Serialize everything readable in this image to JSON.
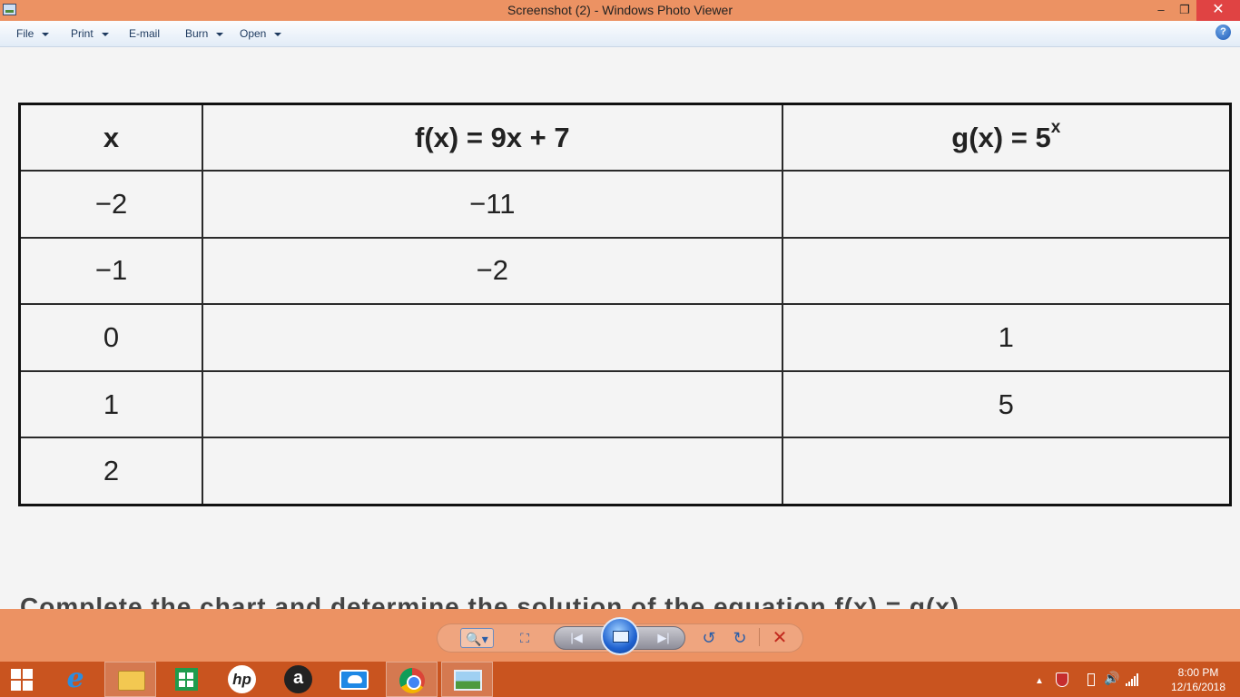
{
  "window": {
    "title": "Screenshot (2) - Windows Photo Viewer",
    "minimize_glyph": "‒",
    "maximize_glyph": "❐",
    "close_glyph": "✕"
  },
  "menu": {
    "items": [
      {
        "label": "File",
        "has_dropdown": true
      },
      {
        "label": "Print",
        "has_dropdown": true
      },
      {
        "label": "E-mail",
        "has_dropdown": false
      },
      {
        "label": "Burn",
        "has_dropdown": true
      },
      {
        "label": "Open",
        "has_dropdown": true
      }
    ],
    "help_glyph": "?"
  },
  "content": {
    "table": {
      "headers": {
        "x": "x",
        "f": "f(x) = 9x + 7",
        "g_base": "g(x) = 5",
        "g_exponent": "x"
      },
      "rows": [
        {
          "x": "−2",
          "f": "−11",
          "g": ""
        },
        {
          "x": "−1",
          "f": "−2",
          "g": ""
        },
        {
          "x": "0",
          "f": "",
          "g": "1"
        },
        {
          "x": "1",
          "f": "",
          "g": "5"
        },
        {
          "x": "2",
          "f": "",
          "g": ""
        }
      ]
    },
    "cut_off_text": "Complete the chart and determine the solution of the equation f(x) = g(x)."
  },
  "controls": {
    "zoom_glyph": "🔍▾",
    "fit_glyph": "⛶",
    "prev_glyph": "|◀",
    "next_glyph": "▶|",
    "rotate_left_glyph": "↺",
    "rotate_right_glyph": "↻",
    "delete_glyph": "✕"
  },
  "taskbar": {
    "ie_glyph": "e",
    "hp_glyph": "hp",
    "amazon_glyph": "a",
    "volume_glyph": "🔊",
    "chevron_glyph": "▲",
    "clock_time": "8:00 PM",
    "clock_date": "12/16/2018"
  },
  "colors": {
    "titlebar": "#ec9263",
    "taskbar": "#c9541f",
    "close_button": "#e04343"
  }
}
